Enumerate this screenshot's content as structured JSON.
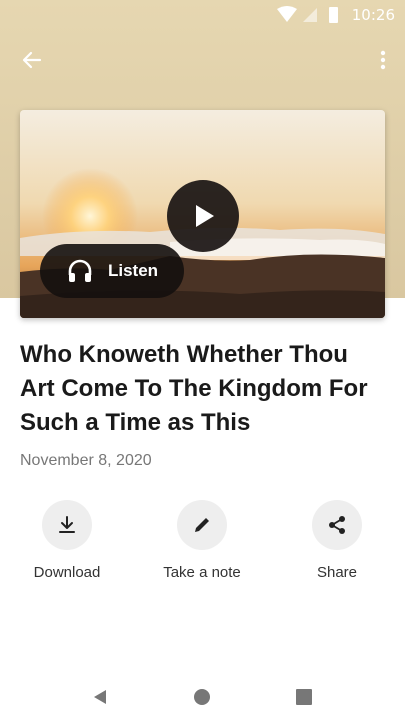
{
  "status_bar": {
    "time": "10:26"
  },
  "article": {
    "title": "Who Knoweth Whether Thou Art Come To The Kingdom For Such a Time as This",
    "date": "November 8, 2020"
  },
  "media": {
    "listen_label": "Listen"
  },
  "actions": [
    {
      "label": "Download",
      "icon": "download-icon"
    },
    {
      "label": "Take a note",
      "icon": "pencil-icon"
    },
    {
      "label": "Share",
      "icon": "share-icon"
    }
  ],
  "colors": {
    "header_bg": "#e6d7b1",
    "text_primary": "#1a1a1a",
    "text_secondary": "#777777",
    "action_bg": "#eeeeee"
  }
}
